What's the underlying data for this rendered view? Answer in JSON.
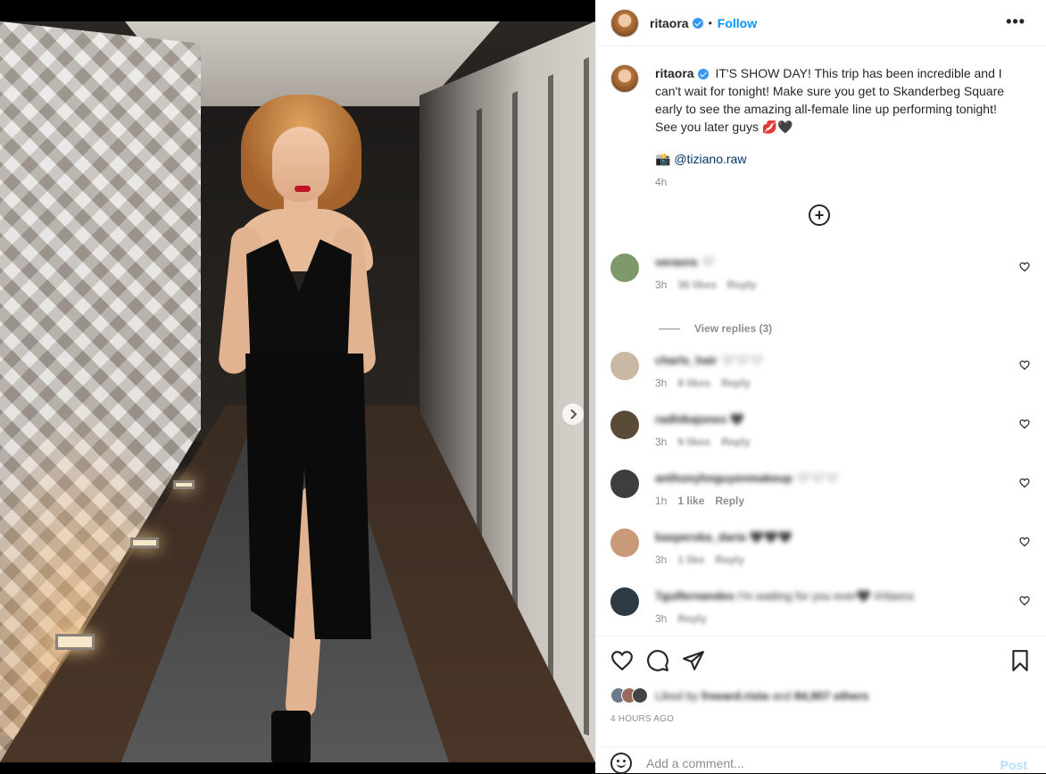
{
  "post": {
    "username": "ritaora",
    "follow_label": "Follow",
    "more_label": "•••",
    "caption_text": "IT'S SHOW DAY! This trip has been incredible and I can't wait for tonight! Make sure you get to Skanderbeg Square early to see the amazing all-female line up performing tonight! See you later guys 💋🖤",
    "mention_glyph": "📸",
    "mention": "@tiziano.raw",
    "caption_time": "4h",
    "plus_label": "+",
    "photo_count": 6,
    "active_photo": 1
  },
  "comments": [
    {
      "user": "veraora",
      "text": "🤍",
      "time": "3h",
      "likes": "36 likes",
      "reply": "Reply",
      "avatar_color": "#7f9a6a",
      "blurred": true
    },
    {
      "user": "charls_hair",
      "text": "🤍🤍🤍",
      "time": "3h",
      "likes": "8 likes",
      "reply": "Reply",
      "avatar_color": "#c9b9a4",
      "blurred": true
    },
    {
      "user": "radhikajones",
      "text": "🖤",
      "time": "3h",
      "likes": "9 likes",
      "reply": "Reply",
      "avatar_color": "#5a4a38",
      "blurred": true
    },
    {
      "user": "anthonyhnguyenmakeup",
      "text": "🤍🤍🤍",
      "time": "1h",
      "likes": "1 like",
      "reply": "Reply",
      "avatar_color": "#3e3e3e",
      "blurred": false
    },
    {
      "user": "kasperska_daria",
      "text": "🖤🖤🖤",
      "time": "3h",
      "likes": "1 like",
      "reply": "Reply",
      "avatar_color": "#c89a7a",
      "blurred": true
    },
    {
      "user": "7gulfernandes",
      "text": "I'm waiting for you ever🖤 #ritaora",
      "time": "3h",
      "likes": "",
      "reply": "Reply",
      "avatar_color": "#2f3b44",
      "blurred": true
    }
  ],
  "view_replies": "View replies (3)",
  "likes_line": {
    "prefix": "Liked by",
    "user": "freeard.rista",
    "and": "and",
    "count": "84,907 others"
  },
  "posted_time": "4 HOURS AGO",
  "comment_box": {
    "placeholder": "Add a comment...",
    "post_label": "Post"
  },
  "colors": {
    "link": "#0095f6",
    "verified": "#3897f0",
    "post_disabled": "#b2dffc"
  }
}
